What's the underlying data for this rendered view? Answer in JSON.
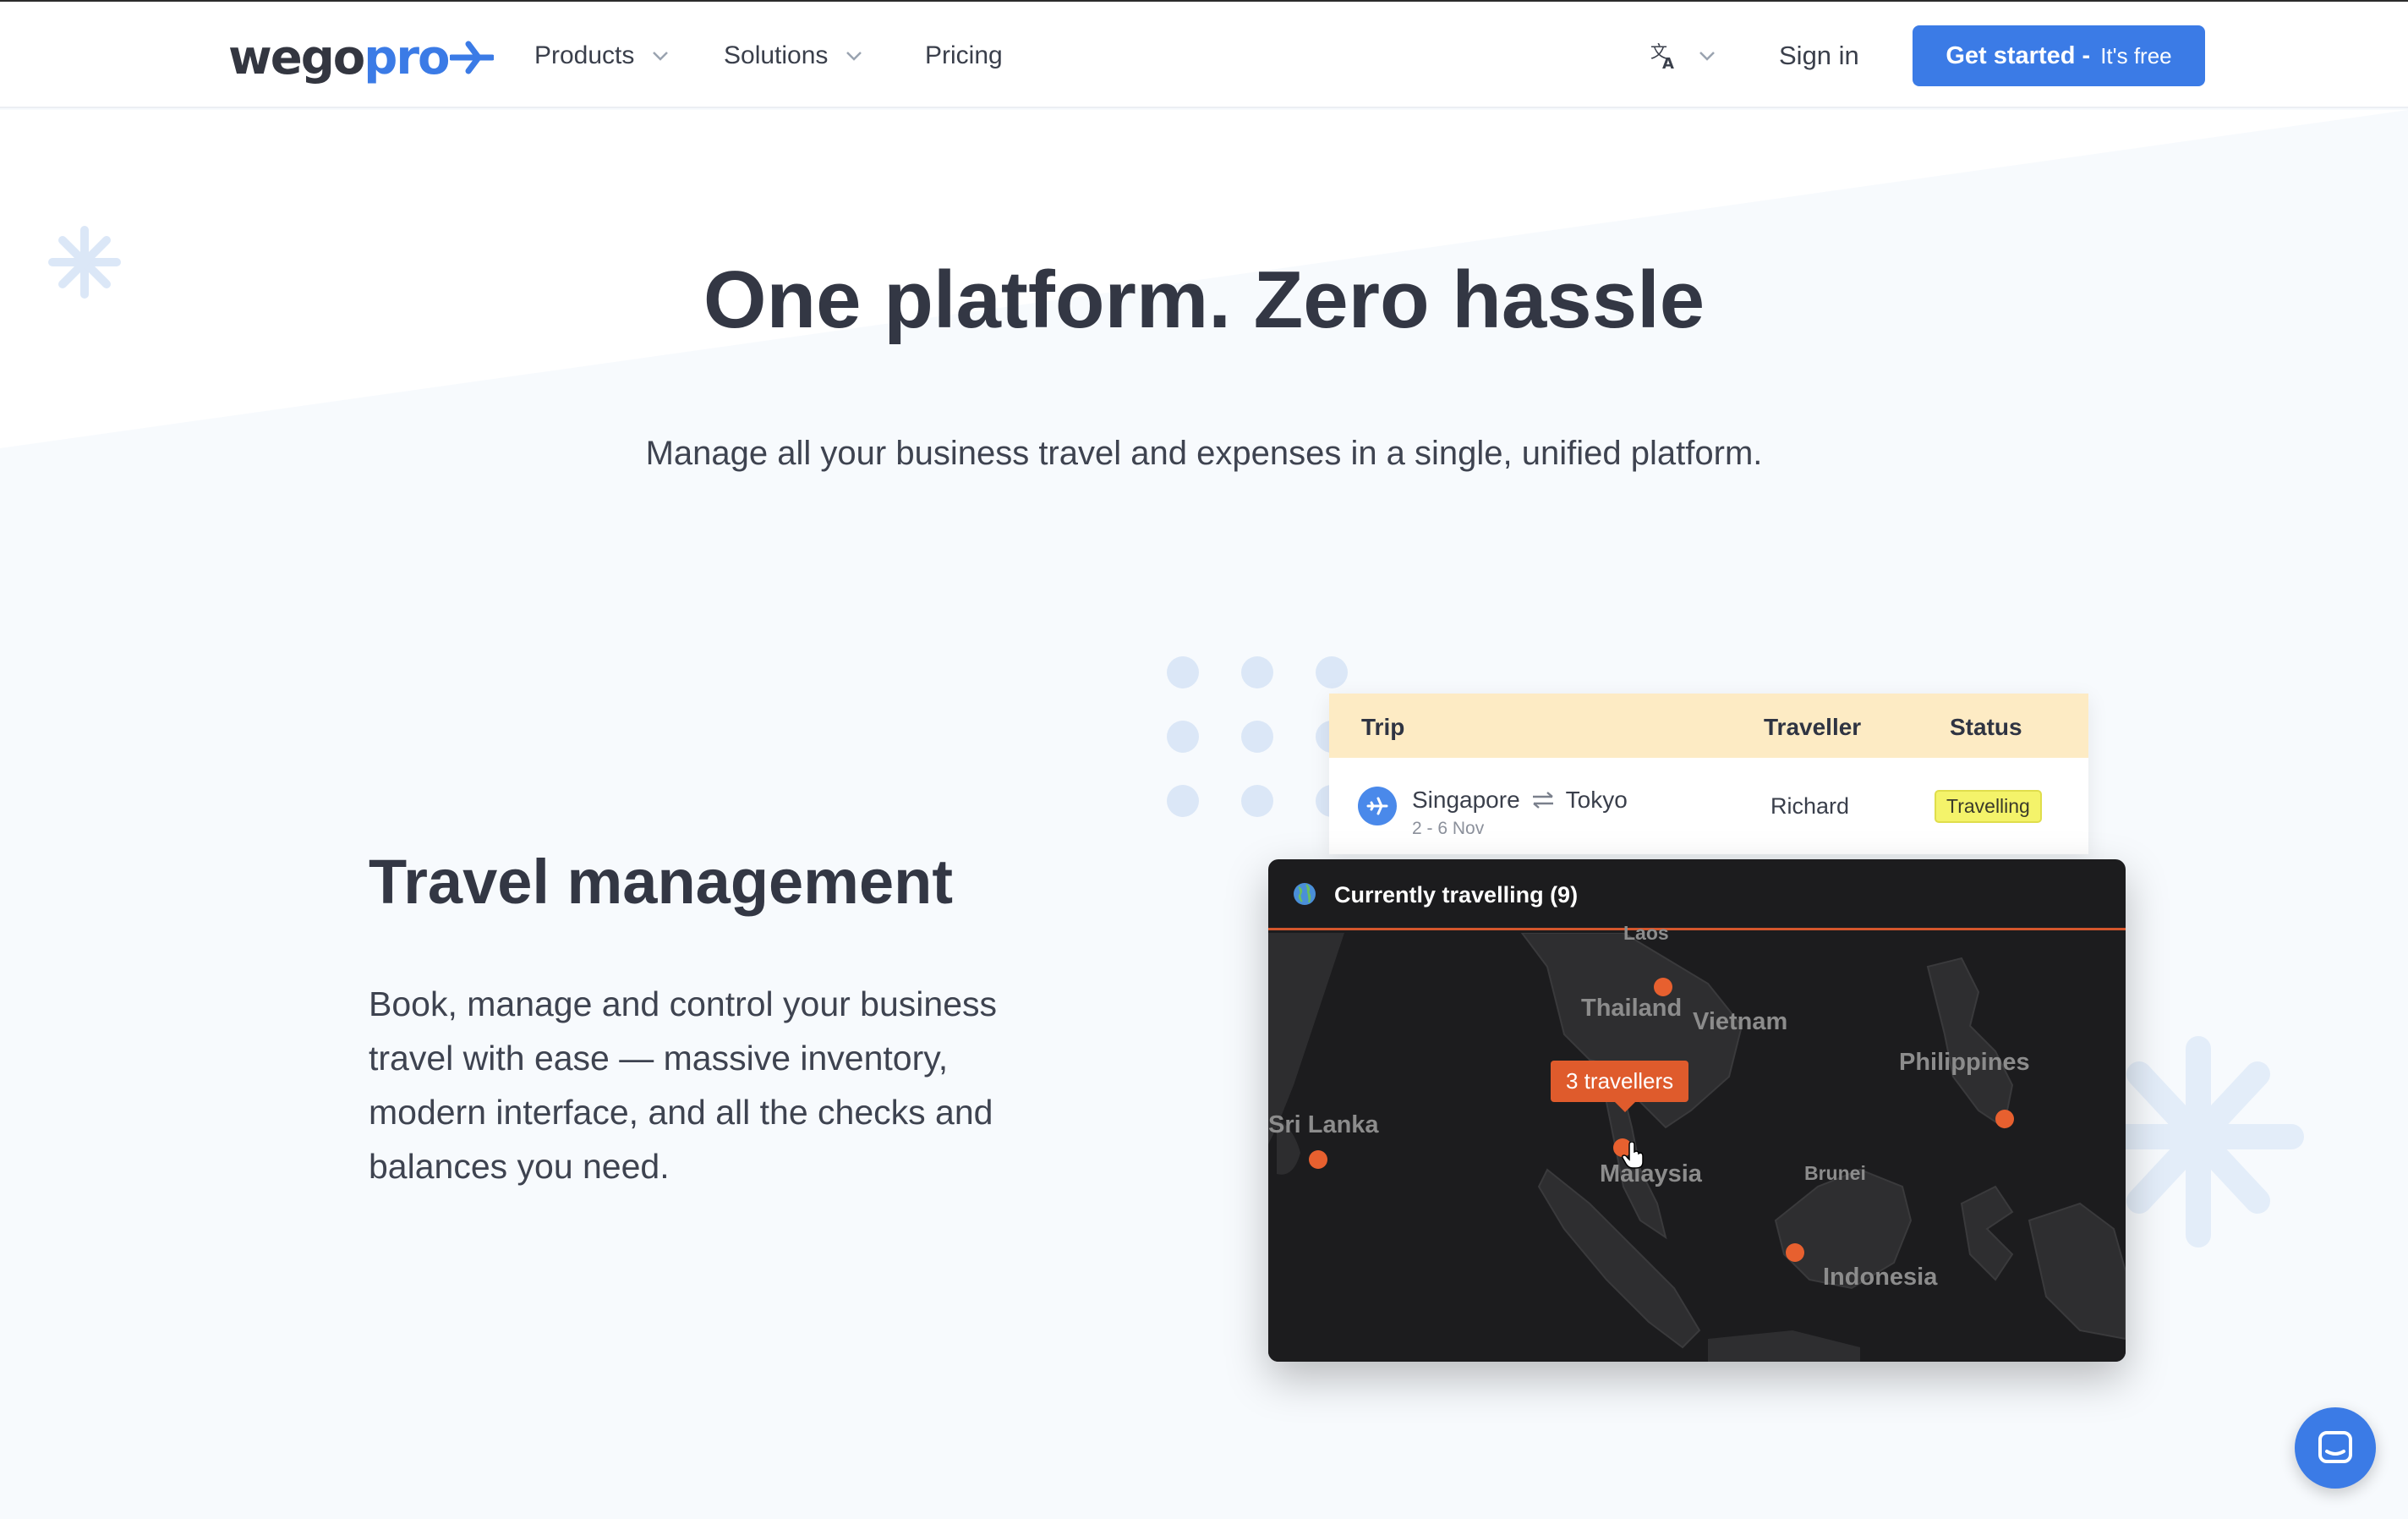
{
  "brand": {
    "logo_part1": "wego",
    "logo_part2": "pro"
  },
  "nav": {
    "items": [
      {
        "label": "Products"
      },
      {
        "label": "Solutions"
      },
      {
        "label": "Pricing"
      }
    ],
    "language_icon": "translate-icon",
    "signin_label": "Sign in",
    "cta_main": "Get started -",
    "cta_sub": "It's free"
  },
  "hero": {
    "title": "One platform. Zero hassle",
    "subtitle": "Manage all your business travel and expenses in a single, unified platform."
  },
  "feature": {
    "title": "Travel management",
    "body": "Book, manage and control your business travel with ease — massive inventory, modern interface, and all the checks and balances you need."
  },
  "trip_table": {
    "columns": [
      "Trip",
      "Traveller",
      "Status"
    ],
    "row": {
      "origin": "Singapore",
      "destination": "Tokyo",
      "dates": "2 - 6 Nov",
      "traveller": "Richard",
      "status": "Travelling"
    }
  },
  "map": {
    "title": "Currently travelling (9)",
    "tooltip": "3 travellers",
    "labels": [
      "Laos",
      "Thailand",
      "Vietnam",
      "Philippines",
      "Sri Lanka",
      "Malaysia",
      "Brunei",
      "Indonesia"
    ]
  },
  "colors": {
    "accent": "#3b7be6",
    "status_bg": "#f4f36a",
    "table_header": "#fdebc4",
    "map_bg": "#1c1c1e",
    "pin": "#e7602f"
  },
  "icons": {
    "chat": "chat-icon",
    "plane": "plane-icon",
    "globe": "globe-icon"
  }
}
